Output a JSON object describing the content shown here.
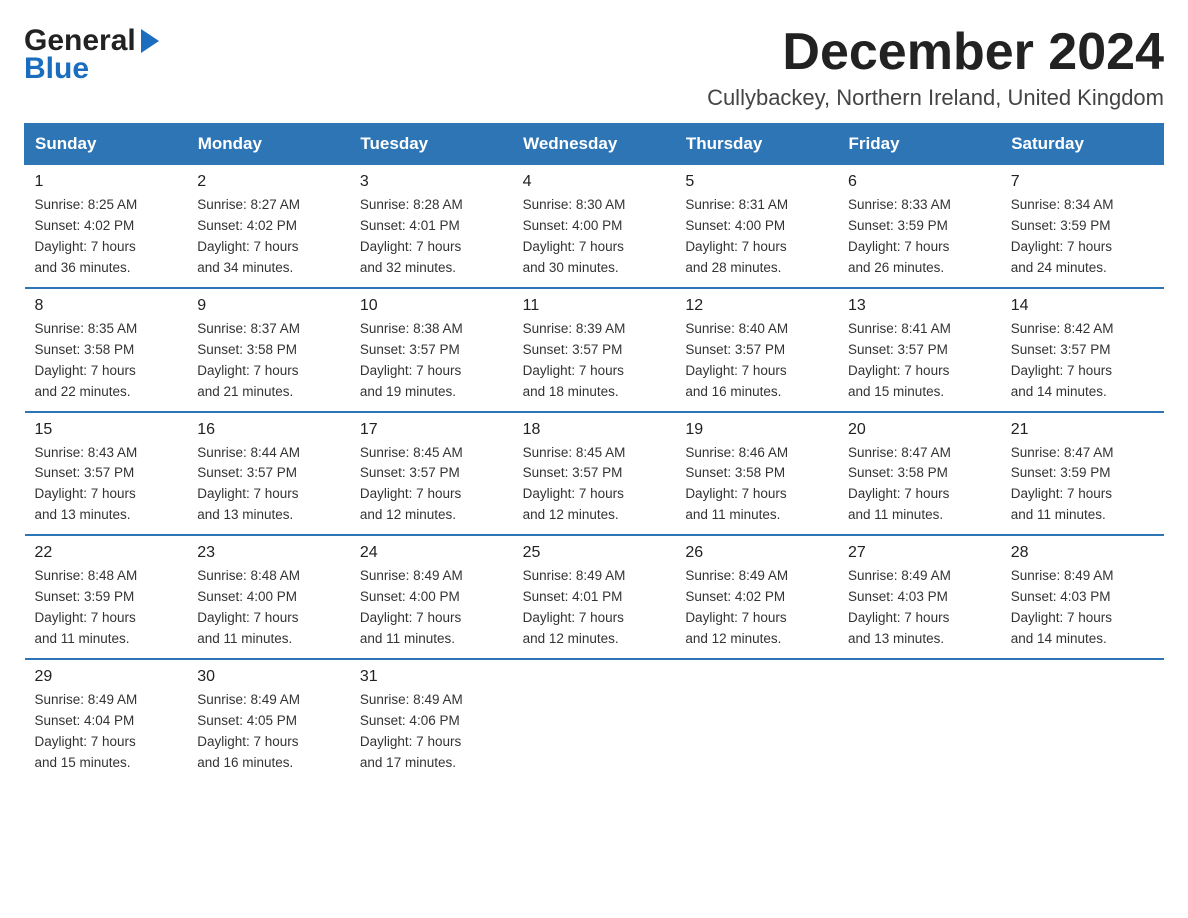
{
  "logo": {
    "general": "General",
    "blue": "Blue"
  },
  "title": "December 2024",
  "subtitle": "Cullybackey, Northern Ireland, United Kingdom",
  "weekdays": [
    "Sunday",
    "Monday",
    "Tuesday",
    "Wednesday",
    "Thursday",
    "Friday",
    "Saturday"
  ],
  "weeks": [
    [
      {
        "day": "1",
        "sunrise": "8:25 AM",
        "sunset": "4:02 PM",
        "daylight": "7 hours and 36 minutes."
      },
      {
        "day": "2",
        "sunrise": "8:27 AM",
        "sunset": "4:02 PM",
        "daylight": "7 hours and 34 minutes."
      },
      {
        "day": "3",
        "sunrise": "8:28 AM",
        "sunset": "4:01 PM",
        "daylight": "7 hours and 32 minutes."
      },
      {
        "day": "4",
        "sunrise": "8:30 AM",
        "sunset": "4:00 PM",
        "daylight": "7 hours and 30 minutes."
      },
      {
        "day": "5",
        "sunrise": "8:31 AM",
        "sunset": "4:00 PM",
        "daylight": "7 hours and 28 minutes."
      },
      {
        "day": "6",
        "sunrise": "8:33 AM",
        "sunset": "3:59 PM",
        "daylight": "7 hours and 26 minutes."
      },
      {
        "day": "7",
        "sunrise": "8:34 AM",
        "sunset": "3:59 PM",
        "daylight": "7 hours and 24 minutes."
      }
    ],
    [
      {
        "day": "8",
        "sunrise": "8:35 AM",
        "sunset": "3:58 PM",
        "daylight": "7 hours and 22 minutes."
      },
      {
        "day": "9",
        "sunrise": "8:37 AM",
        "sunset": "3:58 PM",
        "daylight": "7 hours and 21 minutes."
      },
      {
        "day": "10",
        "sunrise": "8:38 AM",
        "sunset": "3:57 PM",
        "daylight": "7 hours and 19 minutes."
      },
      {
        "day": "11",
        "sunrise": "8:39 AM",
        "sunset": "3:57 PM",
        "daylight": "7 hours and 18 minutes."
      },
      {
        "day": "12",
        "sunrise": "8:40 AM",
        "sunset": "3:57 PM",
        "daylight": "7 hours and 16 minutes."
      },
      {
        "day": "13",
        "sunrise": "8:41 AM",
        "sunset": "3:57 PM",
        "daylight": "7 hours and 15 minutes."
      },
      {
        "day": "14",
        "sunrise": "8:42 AM",
        "sunset": "3:57 PM",
        "daylight": "7 hours and 14 minutes."
      }
    ],
    [
      {
        "day": "15",
        "sunrise": "8:43 AM",
        "sunset": "3:57 PM",
        "daylight": "7 hours and 13 minutes."
      },
      {
        "day": "16",
        "sunrise": "8:44 AM",
        "sunset": "3:57 PM",
        "daylight": "7 hours and 13 minutes."
      },
      {
        "day": "17",
        "sunrise": "8:45 AM",
        "sunset": "3:57 PM",
        "daylight": "7 hours and 12 minutes."
      },
      {
        "day": "18",
        "sunrise": "8:45 AM",
        "sunset": "3:57 PM",
        "daylight": "7 hours and 12 minutes."
      },
      {
        "day": "19",
        "sunrise": "8:46 AM",
        "sunset": "3:58 PM",
        "daylight": "7 hours and 11 minutes."
      },
      {
        "day": "20",
        "sunrise": "8:47 AM",
        "sunset": "3:58 PM",
        "daylight": "7 hours and 11 minutes."
      },
      {
        "day": "21",
        "sunrise": "8:47 AM",
        "sunset": "3:59 PM",
        "daylight": "7 hours and 11 minutes."
      }
    ],
    [
      {
        "day": "22",
        "sunrise": "8:48 AM",
        "sunset": "3:59 PM",
        "daylight": "7 hours and 11 minutes."
      },
      {
        "day": "23",
        "sunrise": "8:48 AM",
        "sunset": "4:00 PM",
        "daylight": "7 hours and 11 minutes."
      },
      {
        "day": "24",
        "sunrise": "8:49 AM",
        "sunset": "4:00 PM",
        "daylight": "7 hours and 11 minutes."
      },
      {
        "day": "25",
        "sunrise": "8:49 AM",
        "sunset": "4:01 PM",
        "daylight": "7 hours and 12 minutes."
      },
      {
        "day": "26",
        "sunrise": "8:49 AM",
        "sunset": "4:02 PM",
        "daylight": "7 hours and 12 minutes."
      },
      {
        "day": "27",
        "sunrise": "8:49 AM",
        "sunset": "4:03 PM",
        "daylight": "7 hours and 13 minutes."
      },
      {
        "day": "28",
        "sunrise": "8:49 AM",
        "sunset": "4:03 PM",
        "daylight": "7 hours and 14 minutes."
      }
    ],
    [
      {
        "day": "29",
        "sunrise": "8:49 AM",
        "sunset": "4:04 PM",
        "daylight": "7 hours and 15 minutes."
      },
      {
        "day": "30",
        "sunrise": "8:49 AM",
        "sunset": "4:05 PM",
        "daylight": "7 hours and 16 minutes."
      },
      {
        "day": "31",
        "sunrise": "8:49 AM",
        "sunset": "4:06 PM",
        "daylight": "7 hours and 17 minutes."
      },
      null,
      null,
      null,
      null
    ]
  ],
  "labels": {
    "sunrise": "Sunrise:",
    "sunset": "Sunset:",
    "daylight": "Daylight:"
  }
}
